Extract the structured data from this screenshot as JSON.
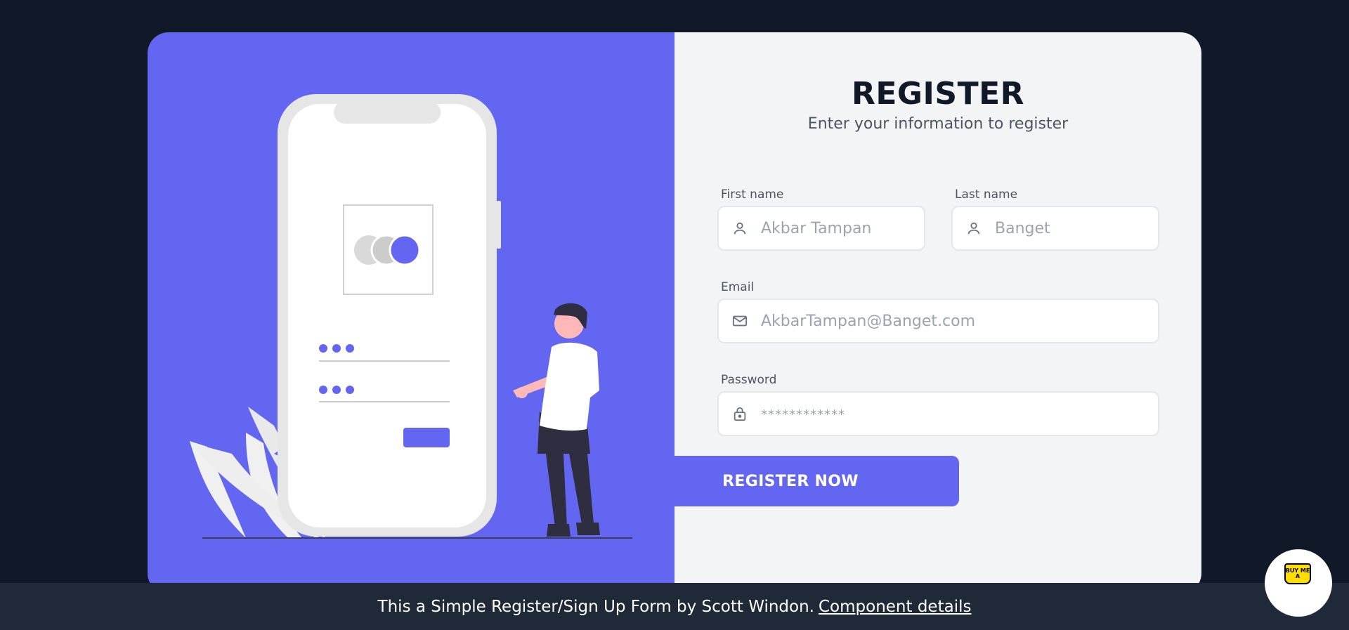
{
  "register": {
    "title": "REGISTER",
    "subtitle": "Enter your information to register"
  },
  "form": {
    "first_name": {
      "label": "First name",
      "placeholder": "Akbar Tampan",
      "icon": "user-icon"
    },
    "last_name": {
      "label": "Last name",
      "placeholder": "Banget",
      "icon": "user-icon"
    },
    "email": {
      "label": "Email",
      "placeholder": "AkbarTampan@Banget.com",
      "icon": "mail-icon"
    },
    "password": {
      "label": "Password",
      "placeholder": "************",
      "icon": "lock-icon"
    },
    "submit_label": "REGISTER NOW"
  },
  "footer": {
    "text": "This a Simple Register/Sign Up Form by Scott Windon.",
    "link_text": "Component details"
  },
  "bmc": {
    "text": "BUY ME A"
  },
  "colors": {
    "background": "#111827",
    "accent": "#6366f1",
    "panel": "#f3f4f6",
    "footer": "#1f2937"
  }
}
